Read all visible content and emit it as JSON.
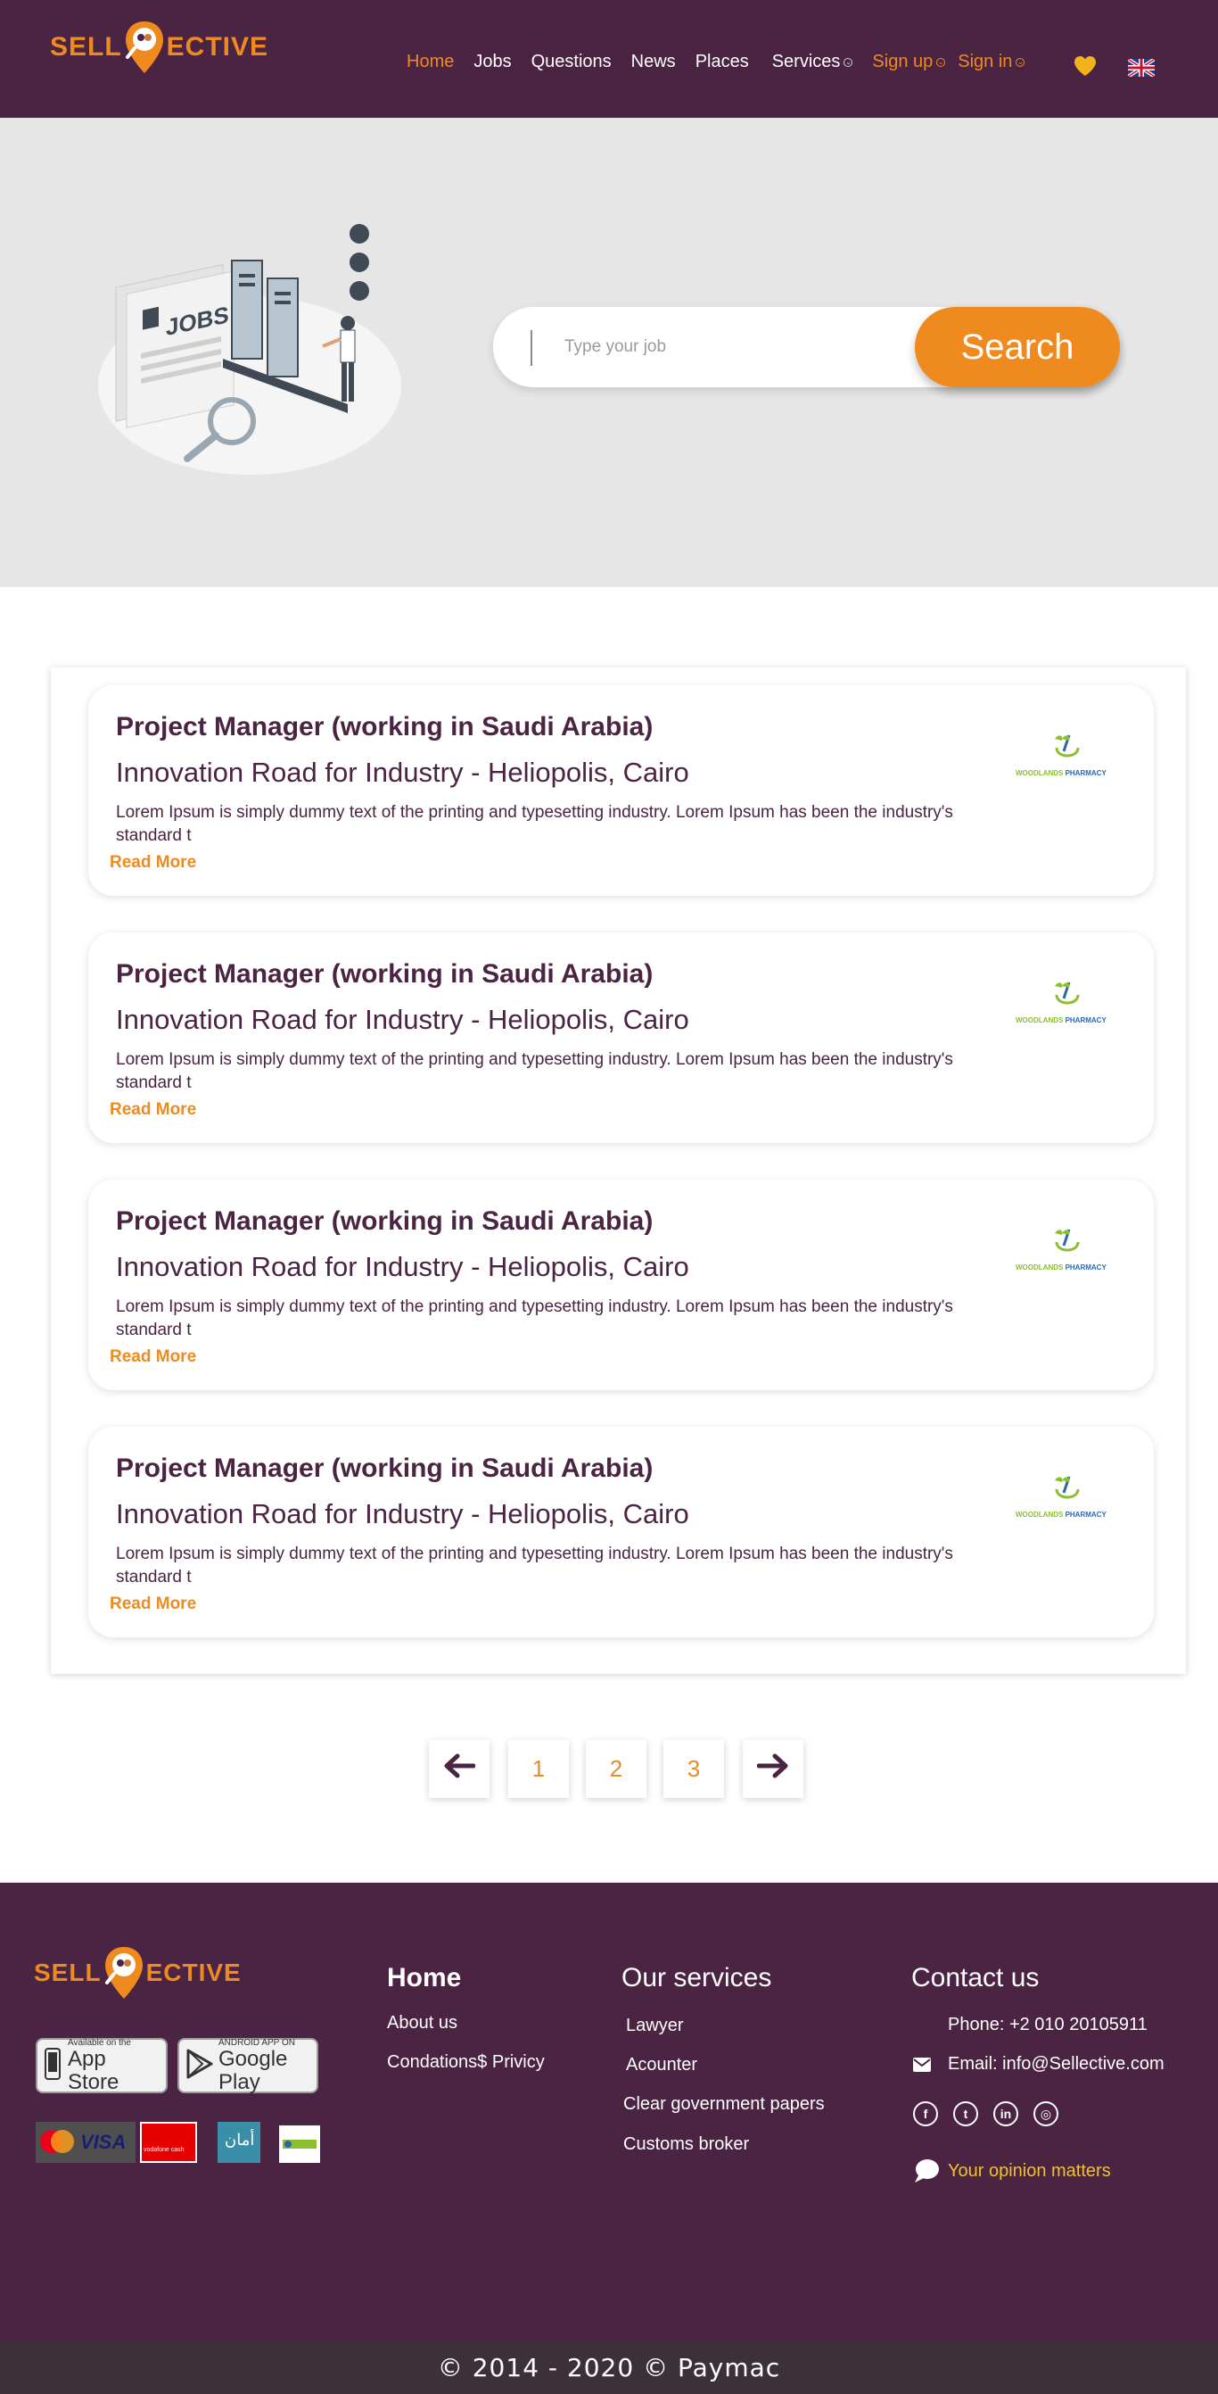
{
  "brand": {
    "logo_left": "SELL",
    "logo_right": "ECTIVE",
    "accent": "#ef8a1f",
    "primary": "#4a2442"
  },
  "nav": {
    "home": "Home",
    "jobs": "Jobs",
    "questions": "Questions",
    "news": "News",
    "places": "Places",
    "services": "Services",
    "sign_up": "Sign up",
    "sign_in": "Sign in",
    "favorites_icon": "heart-icon",
    "language_icon": "uk-flag-icon"
  },
  "hero": {
    "illustration_label": "JOBS",
    "search_placeholder": "Type your job",
    "search_button": "Search"
  },
  "jobs": [
    {
      "title": "Project Manager (working in Saudi Arabia)",
      "company": "Innovation Road for Industry - Heliopolis, Cairo",
      "description": "Lorem Ipsum is simply dummy text of the printing and typesetting industry. Lorem Ipsum has been the industry's standard t",
      "read_more": "Read More",
      "logo_green": "WOODLANDS",
      "logo_blue": "PHARMACY"
    },
    {
      "title": "Project Manager (working in Saudi Arabia)",
      "company": "Innovation Road for Industry - Heliopolis, Cairo",
      "description": "Lorem Ipsum is simply dummy text of the printing and typesetting industry. Lorem Ipsum has been the industry's standard t",
      "read_more": "Read More",
      "logo_green": "WOODLANDS",
      "logo_blue": "PHARMACY"
    },
    {
      "title": "Project Manager (working in Saudi Arabia)",
      "company": "Innovation Road for Industry - Heliopolis, Cairo",
      "description": "Lorem Ipsum is simply dummy text of the printing and typesetting industry. Lorem Ipsum has been the industry's standard t",
      "read_more": "Read More",
      "logo_green": "WOODLANDS",
      "logo_blue": "PHARMACY"
    },
    {
      "title": "Project Manager (working in Saudi Arabia)",
      "company": "Innovation Road for Industry - Heliopolis, Cairo",
      "description": "Lorem Ipsum is simply dummy text of the printing and typesetting industry. Lorem Ipsum has been the industry's standard t",
      "read_more": "Read More",
      "logo_green": "WOODLANDS",
      "logo_blue": "PHARMACY"
    }
  ],
  "pagination": {
    "prev_icon": "arrow-left-icon",
    "pages": [
      "1",
      "2",
      "3"
    ],
    "next_icon": "arrow-right-icon"
  },
  "footer": {
    "app_store_small": "Available on the",
    "app_store_big": "App Store",
    "google_play_small": "ANDROID APP ON",
    "google_play_big": "Google Play",
    "payment_visa": "VISA",
    "payment_vodafone": "vodafone cash",
    "payment_aman": "أمان",
    "col1": {
      "heading": "Home",
      "links": [
        "About us",
        "Condations$ Privicy"
      ]
    },
    "col2": {
      "heading": "Our services",
      "links": [
        "Lawyer",
        "Acounter",
        "Clear government papers",
        "Customs broker"
      ]
    },
    "col3": {
      "heading": "Contact us",
      "phone": "Phone: +2 010 20105911",
      "email": "Email: info@Sellective.com",
      "social_icons": [
        "facebook-icon",
        "twitter-icon",
        "linkedin-icon",
        "instagram-icon"
      ],
      "opinion": "Your opinion matters"
    },
    "copyright": "© 2014 - 2020 © Paymac"
  }
}
